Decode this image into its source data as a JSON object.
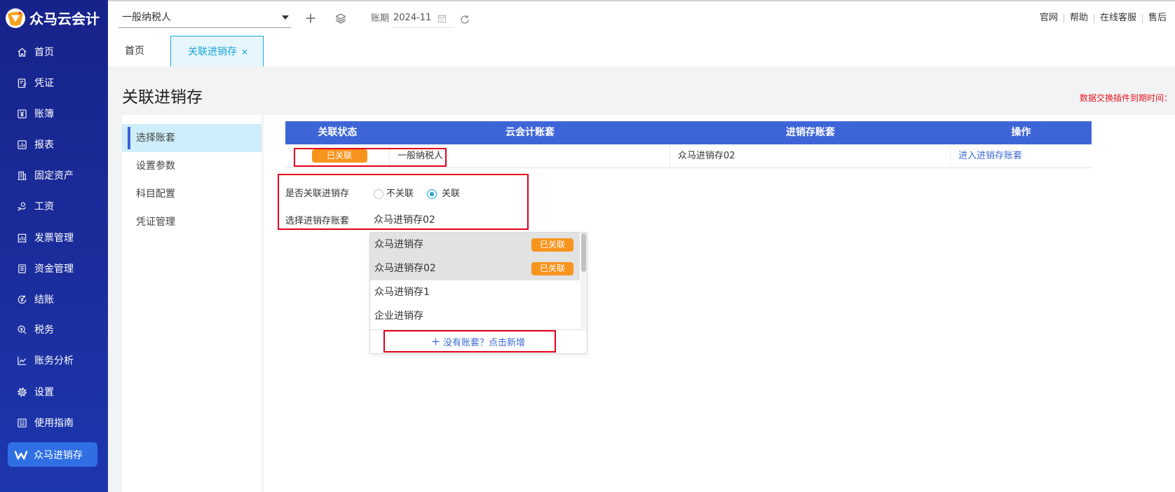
{
  "app": {
    "logo_text": "众马云会计",
    "logo_icon": "zhongma-logo-icon"
  },
  "sidebar": {
    "items": [
      {
        "label": "首页",
        "icon": "home-icon"
      },
      {
        "label": "凭证",
        "icon": "voucher-icon"
      },
      {
        "label": "账簿",
        "icon": "ledger-icon"
      },
      {
        "label": "报表",
        "icon": "report-icon"
      },
      {
        "label": "固定资产",
        "icon": "fixed-asset-icon"
      },
      {
        "label": "工资",
        "icon": "salary-icon"
      },
      {
        "label": "发票管理",
        "icon": "invoice-icon"
      },
      {
        "label": "资金管理",
        "icon": "fund-icon"
      },
      {
        "label": "结账",
        "icon": "closing-icon"
      },
      {
        "label": "税务",
        "icon": "tax-icon"
      },
      {
        "label": "账务分析",
        "icon": "analysis-icon"
      },
      {
        "label": "设置",
        "icon": "settings-icon"
      },
      {
        "label": "使用指南",
        "icon": "guide-icon"
      },
      {
        "label": "众马进销存",
        "icon": "jxc-icon",
        "active": true
      }
    ]
  },
  "header": {
    "account_select": "一般纳税人",
    "period_label": "账期",
    "period_value": "2024-11",
    "links": [
      "官网",
      "帮助",
      "在线客服",
      "售后"
    ]
  },
  "tabs": [
    {
      "label": "首页",
      "active": false
    },
    {
      "label": "关联进销存",
      "active": true,
      "closable": true
    }
  ],
  "page": {
    "title": "关联进销存",
    "notice": "数据交换插件到期时间："
  },
  "subnav": {
    "items": [
      {
        "label": "选择账套",
        "active": true
      },
      {
        "label": "设置参数",
        "active": false
      },
      {
        "label": "科目配置",
        "active": false
      },
      {
        "label": "凭证管理",
        "active": false
      }
    ]
  },
  "table": {
    "columns": [
      "关联状态",
      "云会计账套",
      "进销存账套",
      "操作"
    ],
    "rows": [
      {
        "status": "已关联",
        "cloud_account": "一般纳税人",
        "jxc_account": "众马进销存02",
        "action": "进入进销存账套"
      }
    ]
  },
  "form": {
    "link_label": "是否关联进销存",
    "options": [
      {
        "label": "不关联",
        "checked": false
      },
      {
        "label": "关联",
        "checked": true
      }
    ],
    "select_label": "选择进销存账套",
    "select_value": "众马进销存02"
  },
  "dropdown": {
    "items": [
      {
        "label": "众马进销存",
        "badge": "已关联",
        "linked": true
      },
      {
        "label": "众马进销存02",
        "badge": "已关联",
        "linked": true
      },
      {
        "label": "众马进销存1",
        "linked": false
      },
      {
        "label": "企业进销存",
        "linked": false
      }
    ],
    "add_text": "没有账套？点击新增"
  },
  "colors": {
    "sidebar_top": "#17238a",
    "sidebar_bottom": "#1d37ae",
    "sidebar_active": "#2f6fe3",
    "accent": "#1aa3d9",
    "table_header": "#3e65d8",
    "badge": "#f7941d",
    "link": "#3d6ad6",
    "notice": "#e5141f",
    "annotation": "#e3001b"
  }
}
